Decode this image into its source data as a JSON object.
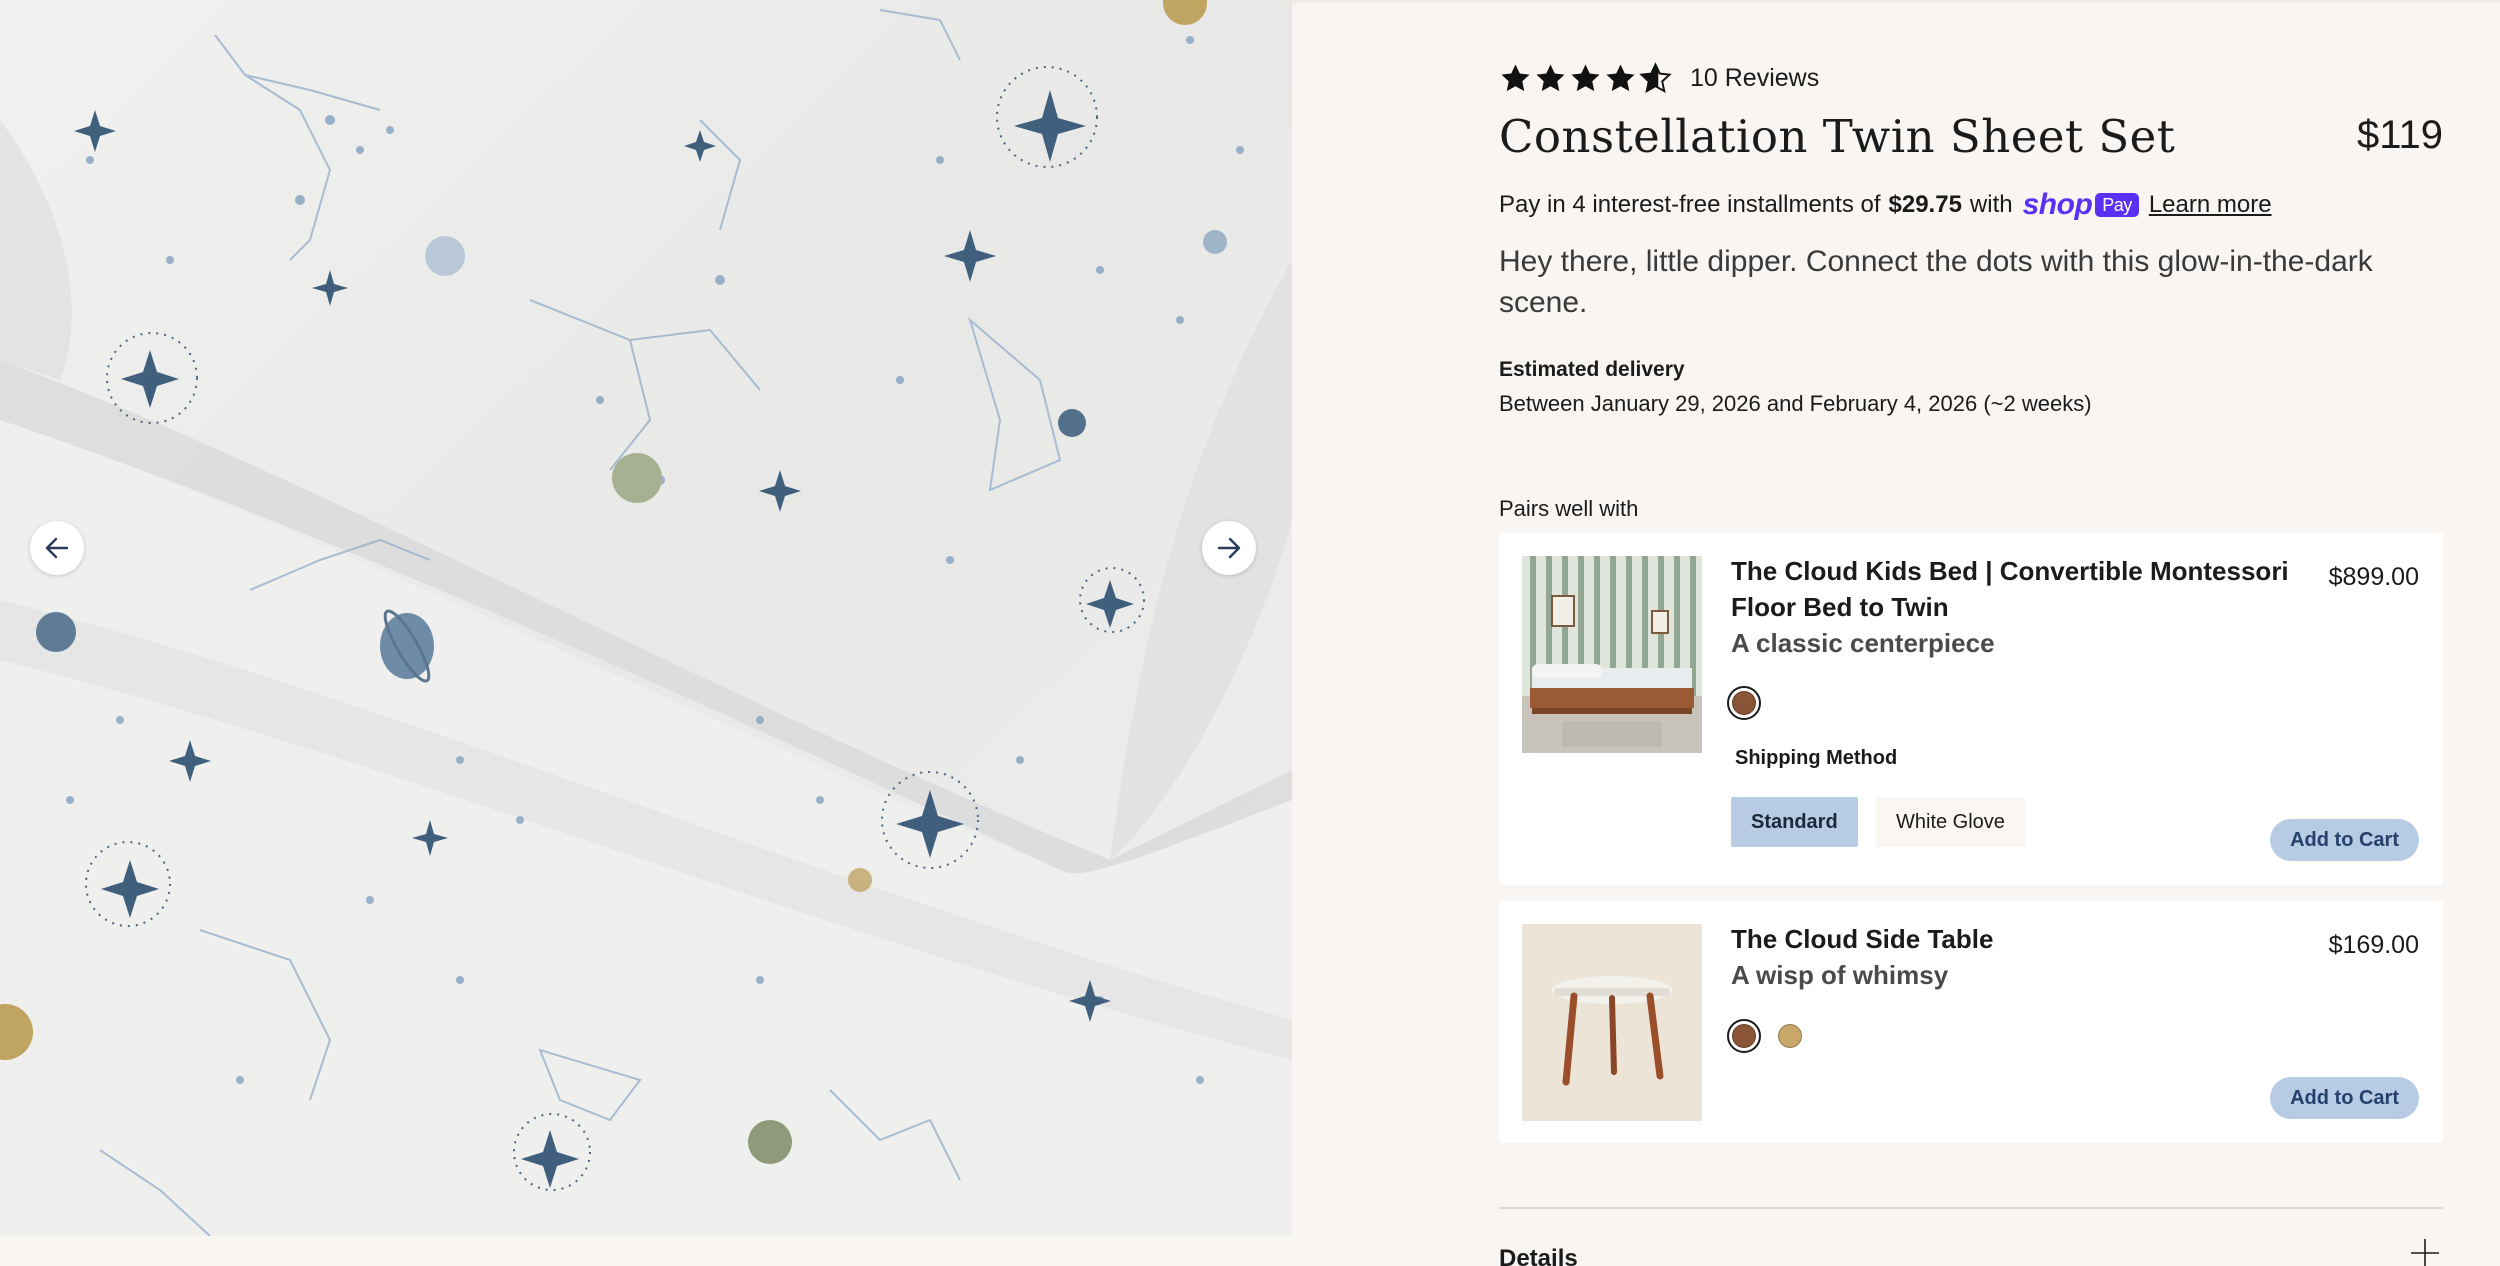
{
  "gallery": {
    "prev_icon": "arrow-left-icon",
    "next_icon": "arrow-right-icon"
  },
  "product": {
    "rating": 4.5,
    "reviews": "10 Reviews",
    "title": "Constellation Twin Sheet Set",
    "price": "$119",
    "installments_prefix": "Pay in 4 interest-free installments of",
    "installments_amount": "$29.75",
    "installments_with": "with",
    "shop_pay_logo": "shop",
    "shop_pay_badge": "Pay",
    "learn_more": "Learn more",
    "description": "Hey there, little dipper. Connect the dots with this glow-in-the-dark scene.",
    "delivery_heading": "Estimated delivery",
    "delivery_text": "Between January 29, 2026 and February 4, 2026 (~2 weeks)"
  },
  "pairs": {
    "heading": "Pairs well with",
    "items": [
      {
        "name": "The Cloud Kids Bed | Convertible Montessori Floor Bed to Twin",
        "subtitle": "A classic centerpiece",
        "price": "$899.00",
        "swatches": [
          "#8a5438"
        ],
        "shipping_label": "Shipping Method",
        "shipping_options": [
          "Standard",
          "White Glove"
        ],
        "selected_shipping": "Standard",
        "cart_label": "Add to Cart"
      },
      {
        "name": "The Cloud Side Table",
        "subtitle": "A wisp of whimsy",
        "price": "$169.00",
        "swatches": [
          "#8a5438",
          "#c9a66a"
        ],
        "cart_label": "Add to Cart"
      }
    ]
  },
  "details": {
    "label": "Details",
    "icon": "plus-icon"
  },
  "colors": {
    "accent_button": "#b7cbe5",
    "shop_pay": "#5a31f4",
    "page_bg": "#f8f5f2"
  }
}
